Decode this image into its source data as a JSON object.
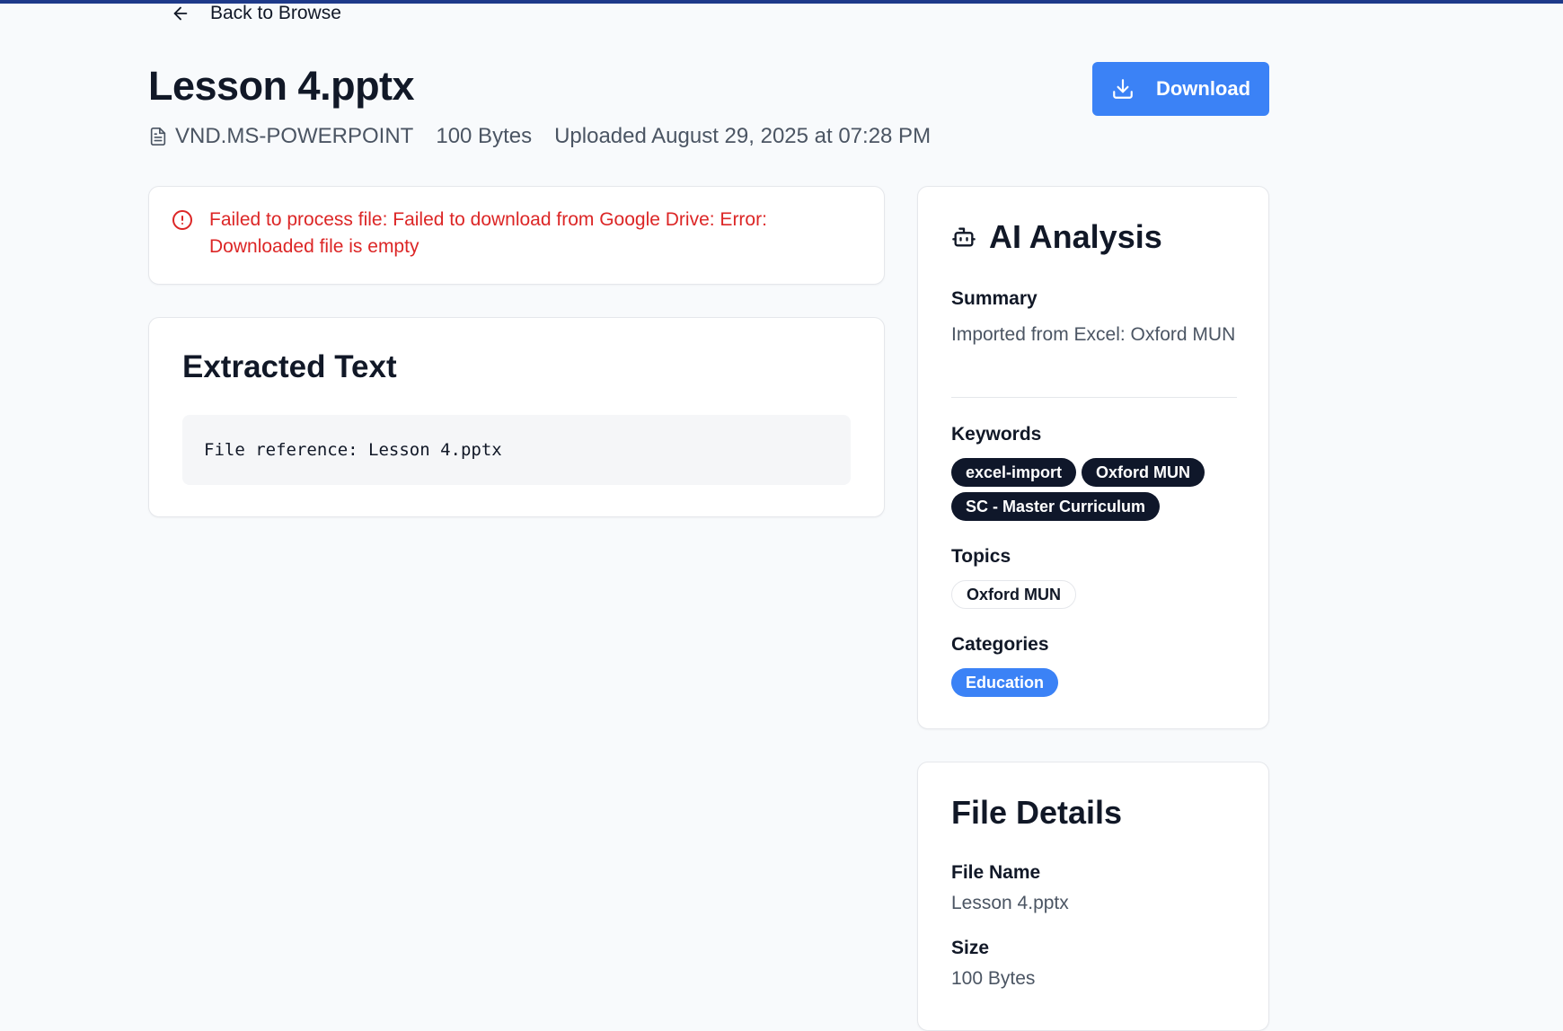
{
  "nav": {
    "back_label": "Back to Browse"
  },
  "file": {
    "title": "Lesson 4.pptx",
    "type": "VND.MS-POWERPOINT",
    "size": "100 Bytes",
    "uploaded": "Uploaded August 29, 2025 at 07:28 PM"
  },
  "actions": {
    "download_label": "Download"
  },
  "error": {
    "message": "Failed to process file: Failed to download from Google Drive: Error: Downloaded file is empty"
  },
  "extracted": {
    "heading": "Extracted Text",
    "content": "File reference: Lesson 4.pptx"
  },
  "ai": {
    "heading": "AI Analysis",
    "summary_label": "Summary",
    "summary": "Imported from Excel: Oxford MUN",
    "keywords_label": "Keywords",
    "keywords": [
      "excel-import",
      "Oxford MUN",
      "SC - Master Curriculum"
    ],
    "topics_label": "Topics",
    "topics": [
      "Oxford MUN"
    ],
    "categories_label": "Categories",
    "categories": [
      "Education"
    ]
  },
  "details": {
    "heading": "File Details",
    "name_label": "File Name",
    "name": "Lesson 4.pptx",
    "size_label": "Size",
    "size": "100 Bytes"
  },
  "colors": {
    "accent": "#3b82f6",
    "error": "#dc2626",
    "chip_dark": "#0f172a",
    "topbar": "#1e3a8a"
  }
}
